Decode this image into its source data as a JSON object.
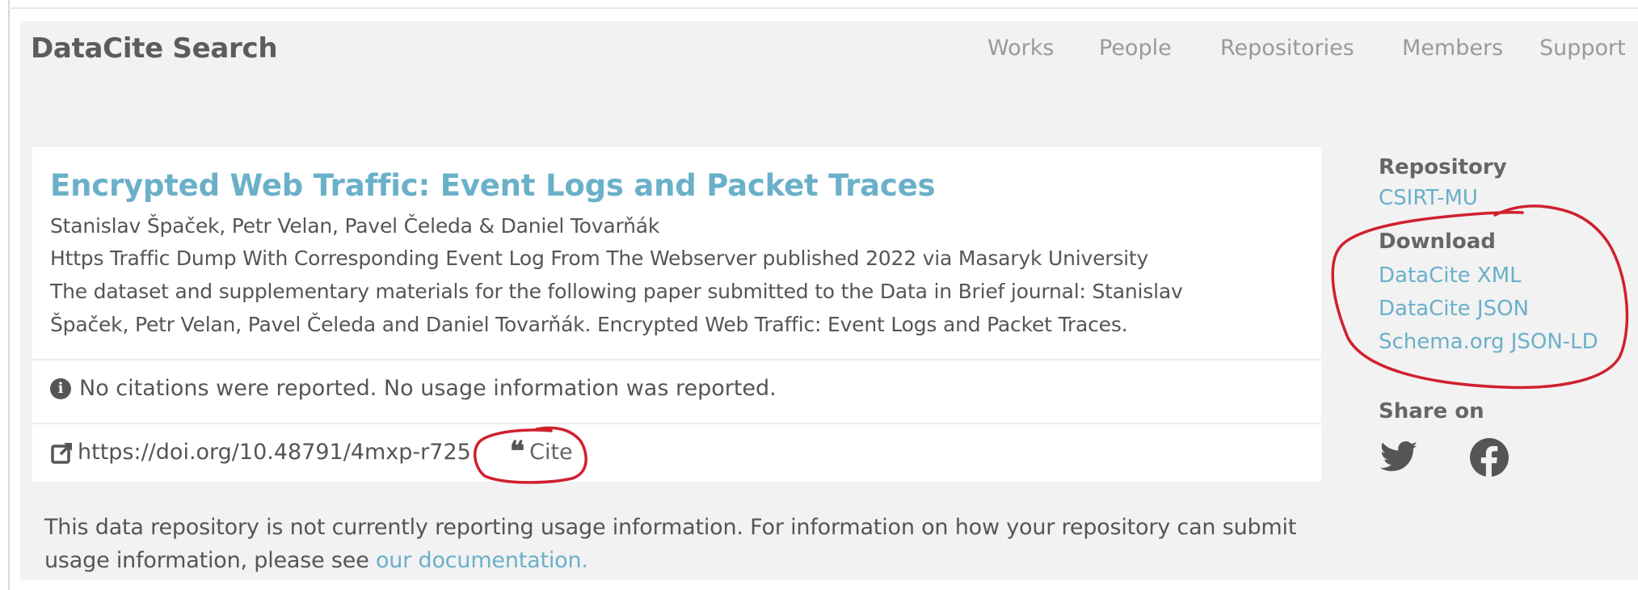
{
  "header": {
    "brand": "DataCite Search",
    "nav": [
      "Works",
      "People",
      "Repositories",
      "Members",
      "Support"
    ]
  },
  "work": {
    "title": "Encrypted Web Traffic: Event Logs and Packet Traces",
    "authors": "Stanislav Špaček, Petr Velan, Pavel Čeleda & Daniel Tovarňák",
    "subtitle": "Https Traffic Dump With Corresponding Event Log From The Webserver published 2022 via Masaryk University",
    "description_line1": "The dataset and supplementary materials for the following paper submitted to the Data in Brief journal: Stanislav",
    "description_line2": "Špaček, Petr Velan, Pavel Čeleda and Daniel Tovarňák. Encrypted Web Traffic: Event Logs and Packet Traces.",
    "info": "No citations were reported. No usage information was reported.",
    "doi": "https://doi.org/10.48791/4mxp-r725",
    "cite_label": "Cite"
  },
  "usage_note": {
    "line1": "This data repository is not currently reporting usage information. For information on how your repository can submit",
    "line2_prefix": "usage information, please see ",
    "link": "our documentation."
  },
  "sidebar": {
    "repository_heading": "Repository",
    "repository": "CSIRT-MU",
    "download_heading": "Download",
    "downloads": [
      "DataCite XML",
      "DataCite JSON",
      "Schema.org JSON-LD"
    ],
    "share_heading": "Share on",
    "share_icons": [
      "twitter-icon",
      "facebook-icon"
    ]
  },
  "colors": {
    "accent": "#6ab0c9",
    "annotation": "#d0202e",
    "page_background": "#f2f2f2"
  }
}
